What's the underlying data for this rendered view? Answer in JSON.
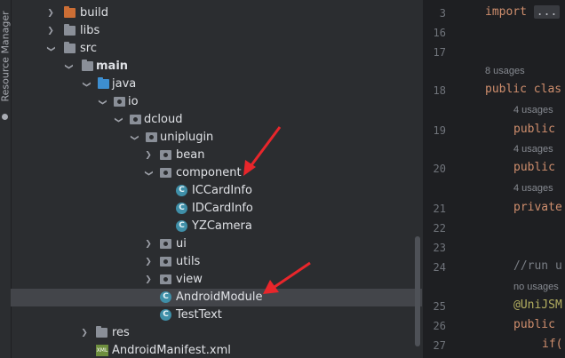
{
  "sidebar": {
    "label": "Resource Manager"
  },
  "tree": {
    "items": [
      {
        "label": "build"
      },
      {
        "label": "libs"
      },
      {
        "label": "src"
      },
      {
        "label": "main"
      },
      {
        "label": "java"
      },
      {
        "label": "io"
      },
      {
        "label": "dcloud"
      },
      {
        "label": "uniplugin"
      },
      {
        "label": "bean"
      },
      {
        "label": "component"
      },
      {
        "label": "ICCardInfo"
      },
      {
        "label": "IDCardInfo"
      },
      {
        "label": "YZCamera"
      },
      {
        "label": "ui"
      },
      {
        "label": "utils"
      },
      {
        "label": "view"
      },
      {
        "label": "AndroidModule"
      },
      {
        "label": "TestText"
      },
      {
        "label": "res"
      },
      {
        "label": "AndroidManifest.xml"
      }
    ],
    "class_badge": "C",
    "xml_badge": "XML"
  },
  "editor": {
    "line_numbers": [
      "3",
      "16",
      "17",
      "18",
      "19",
      "20",
      "21",
      "22",
      "23",
      "24",
      "25",
      "26",
      "27"
    ],
    "code": {
      "import_kw": "import",
      "import_fold": "...",
      "class_kw": "public clas",
      "public1": "public",
      "public2": "public",
      "private": "private",
      "comment": "//run u",
      "annotation": "@UniJSM",
      "public3": "public",
      "if": "if("
    },
    "usages": {
      "u1": "8 usages",
      "u2": "4 usages",
      "u3": "4 usages",
      "u4": "4 usages",
      "u5": "no usages"
    }
  }
}
